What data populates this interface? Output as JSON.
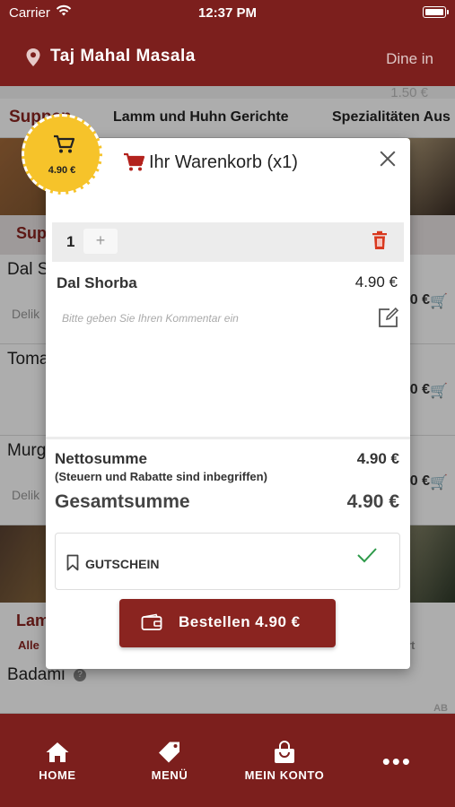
{
  "status_bar": {
    "carrier": "Carrier",
    "time": "12:37 PM"
  },
  "header": {
    "title": "Taj Mahal Masala",
    "mode": "Dine in"
  },
  "background": {
    "ghost_price": "1.50 €",
    "tabs": [
      "Suppen",
      "Lamm und Huhn Gerichte",
      "Spezialitäten Aus"
    ],
    "section_title": "Sup",
    "items": [
      {
        "name": "Dal S",
        "desc": "Delik",
        "price": "0 €"
      },
      {
        "name": "Toma",
        "desc": "",
        "price": "0 €"
      },
      {
        "name": "Murg",
        "desc": "Delik",
        "price": "0 €"
      }
    ],
    "section2_title": "Lam",
    "section2_sub": "Alle",
    "section2_right": "rt",
    "badami": "Badami",
    "ab": "AB"
  },
  "cart_badge": {
    "amount": "4.90 €"
  },
  "modal": {
    "title": "Ihr Warenkorb (x1)",
    "quantity": "1",
    "plus": "+",
    "item_name": "Dal Shorba",
    "item_price": "4.90 €",
    "comment_placeholder": "Bitte geben Sie Ihren Kommentar ein",
    "net_label": "Nettosumme",
    "net_note": "(Steuern und Rabatte sind inbegriffen)",
    "net_value": "4.90 €",
    "total_label": "Gesamtsumme",
    "total_value": "4.90 €",
    "coupon_label": "GUTSCHEIN",
    "order_button": "Bestellen 4.90 €"
  },
  "bottom_nav": {
    "items": [
      {
        "label": "HOME",
        "icon": "home-icon"
      },
      {
        "label": "MENÜ",
        "icon": "tag-icon"
      },
      {
        "label": "MEIN KONTO",
        "icon": "bag-icon"
      }
    ],
    "more": "•••"
  },
  "colors": {
    "brand": "#7c1f1d",
    "accent": "#f6c32a",
    "button": "#8a2420",
    "check": "#2e9a4a",
    "trash": "#d9381e"
  }
}
